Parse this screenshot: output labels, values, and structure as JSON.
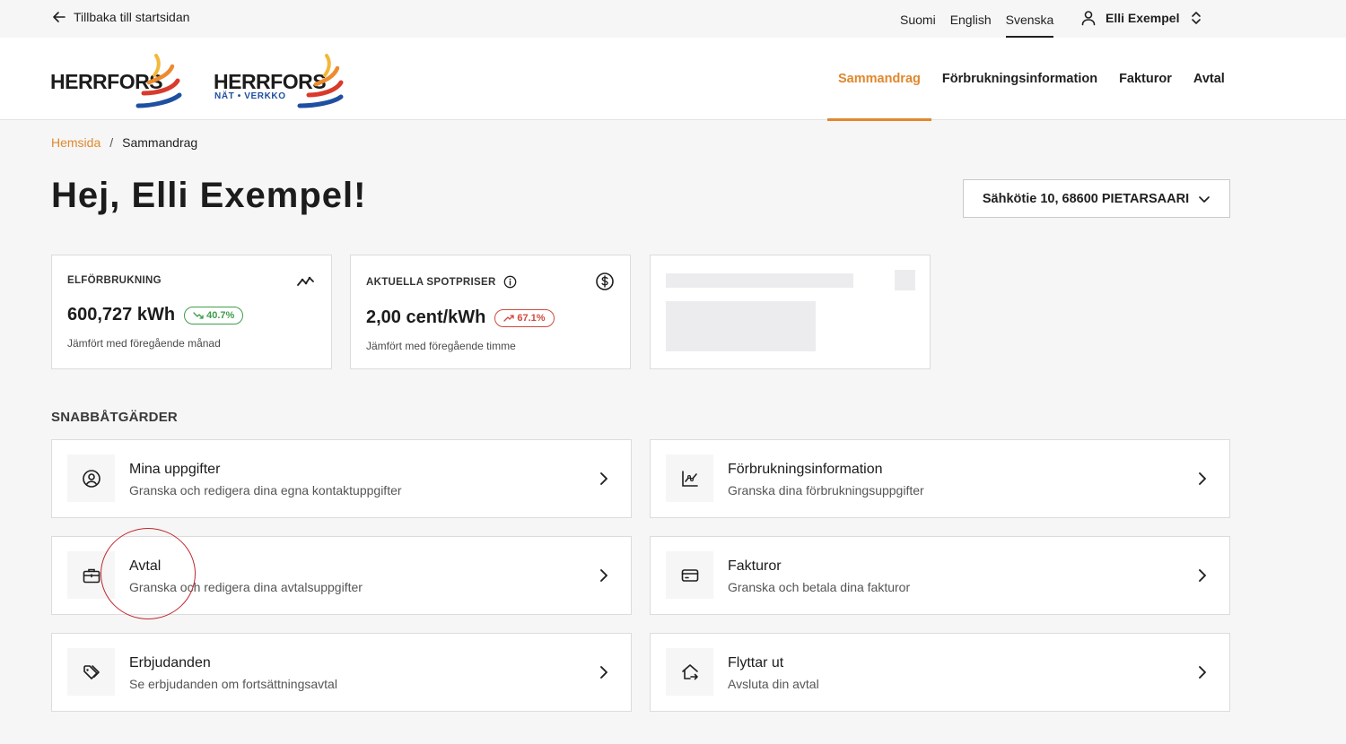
{
  "topbar": {
    "back_label": "Tillbaka till startsidan",
    "languages": [
      "Suomi",
      "English",
      "Svenska"
    ],
    "active_language": "Svenska",
    "user_name": "Elli Exempel"
  },
  "header": {
    "logo1_text": "HERRFORS",
    "logo2_text": "HERRFORS",
    "logo2_sub": "NÄT • VERKKO",
    "nav": [
      "Sammandrag",
      "Förbrukningsinformation",
      "Fakturor",
      "Avtal"
    ],
    "active_nav": "Sammandrag"
  },
  "breadcrumb": {
    "home": "Hemsida",
    "separator": "/",
    "current": "Sammandrag"
  },
  "page": {
    "title": "Hej, Elli Exempel!",
    "address": "Sähkötie 10, 68600 PIETARSAARI"
  },
  "cards": {
    "consumption": {
      "label": "ELFÖRBRUKNING",
      "value": "600,727 kWh",
      "change": "40.7%",
      "note": "Jämfört med föregående månad"
    },
    "spot": {
      "label": "AKTUELLA SPOTPRISER",
      "value": "2,00 cent/kWh",
      "change": "67.1%",
      "note": "Jämfört med föregående timme"
    }
  },
  "quick_actions": {
    "title": "SNABBÅTGÄRDER",
    "items": [
      {
        "title": "Mina uppgifter",
        "desc": "Granska och redigera dina egna kontaktuppgifter",
        "icon": "user-circle-icon"
      },
      {
        "title": "Förbrukningsinformation",
        "desc": "Granska dina förbrukningsuppgifter",
        "icon": "chart-icon"
      },
      {
        "title": "Avtal",
        "desc": "Granska och redigera dina avtalsuppgifter",
        "icon": "briefcase-icon"
      },
      {
        "title": "Fakturor",
        "desc": "Granska och betala dina fakturor",
        "icon": "credit-card-icon"
      },
      {
        "title": "Erbjudanden",
        "desc": "Se erbjudanden om fortsättningsavtal",
        "icon": "tags-icon"
      },
      {
        "title": "Flyttar ut",
        "desc": "Avsluta din avtal",
        "icon": "house-move-icon"
      }
    ]
  },
  "colors": {
    "accent": "#e0882d",
    "positive": "#3f9d4c",
    "negative": "#d24a3d",
    "annotation": "#c0272d"
  }
}
